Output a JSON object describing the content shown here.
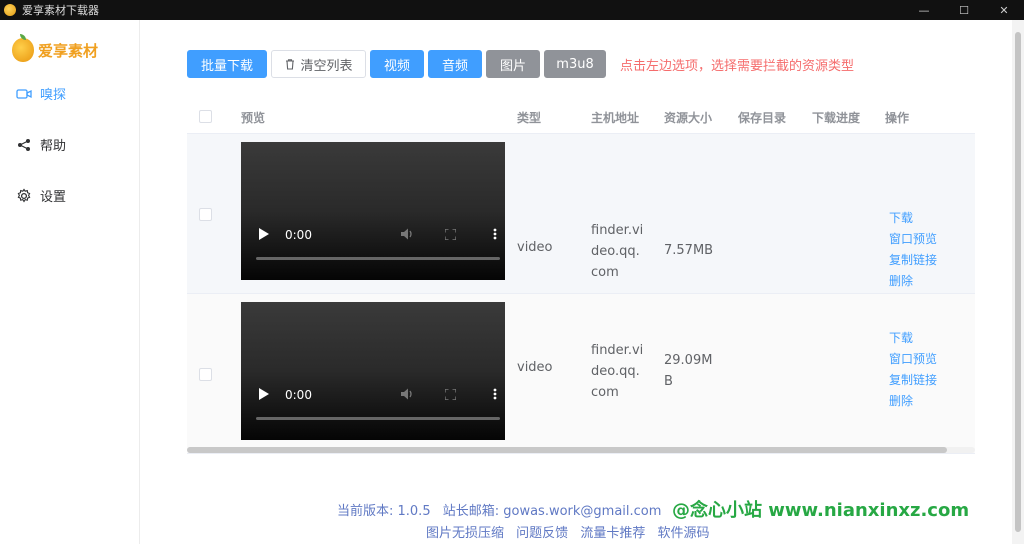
{
  "window": {
    "title": "爱享素材下载器",
    "controls": [
      "—",
      "☐",
      "✕"
    ]
  },
  "sidebar": {
    "brand": "爱享素材",
    "items": [
      {
        "label": "嗅探",
        "icon": "video-camera-icon",
        "active": true
      },
      {
        "label": "帮助",
        "icon": "share-icon",
        "active": false
      },
      {
        "label": "设置",
        "icon": "gear-icon",
        "active": false
      }
    ]
  },
  "toolbar": {
    "batch_download": "批量下载",
    "clear_list": "清空列表",
    "video": "视频",
    "audio": "音频",
    "image": "图片",
    "m3u8": "m3u8",
    "hint": "点击左边选项，选择需要拦截的资源类型"
  },
  "table": {
    "headers": {
      "preview": "预览",
      "type": "类型",
      "host": "主机地址",
      "size": "资源大小",
      "save_dir": "保存目录",
      "progress": "下载进度",
      "actions": "操作"
    },
    "rows": [
      {
        "type": "video",
        "host": [
          "finder.vi",
          "deo.qq.",
          "com"
        ],
        "size": [
          "7.57MB"
        ],
        "time": "0:00"
      },
      {
        "type": "video",
        "host": [
          "finder.vi",
          "deo.qq.",
          "com"
        ],
        "size": [
          "29.09M",
          "B"
        ],
        "time": "0:00"
      }
    ],
    "actions": {
      "download": "下载",
      "window_preview": "窗口预览",
      "copy_link": "复制链接",
      "delete": "删除"
    }
  },
  "footer": {
    "version_label": "当前版本: 1.0.5",
    "email_label": "站长邮箱: gowas.work@gmail.com",
    "links": [
      "图片无损压缩",
      "问题反馈",
      "流量卡推荐",
      "软件源码"
    ]
  },
  "watermark": "@念心小站 www.nianxinxz.com",
  "colors": {
    "primary": "#409eff",
    "gray_button": "#909399",
    "hint": "#f56c6c",
    "brand": "#f0a020",
    "footer_link": "#6079c4"
  }
}
